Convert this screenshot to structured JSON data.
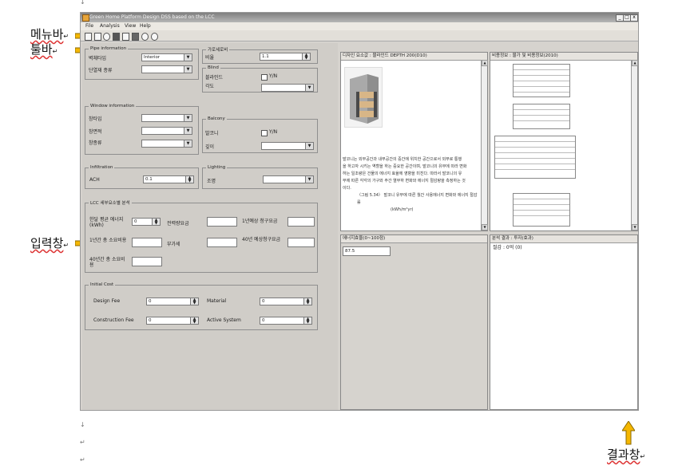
{
  "doc": {
    "marks": [
      "↓",
      "↓",
      "↵",
      "↵"
    ],
    "annotations": {
      "menubar": "메뉴바",
      "toolbar": "툴바",
      "input_window": "입력창",
      "result_window": "결과창",
      "return_mark": "↵"
    }
  },
  "window": {
    "title": "Green Home Platform Design DSS based on the LCC",
    "buttons": [
      "_",
      "□",
      "x"
    ]
  },
  "menu": [
    "File",
    "Analysis",
    "View",
    "Help"
  ],
  "toolbar_icons": [
    "open-icon",
    "new-icon",
    "edit-icon",
    "save-icon",
    "table-icon",
    "chart-icon",
    "settings-icon",
    "info-icon"
  ],
  "left": {
    "pipe": {
      "legend": "Pipe information",
      "wall_type_label": "벽체타입",
      "wall_type_value": "Interior",
      "insulation_label": "단열재 종류",
      "insulation_value": ""
    },
    "shading": {
      "legend": "가로세로비",
      "ratio_label": "비율",
      "ratio_value": "1.1"
    },
    "blind": {
      "legend": "Blind",
      "blind_label": "블라인드",
      "check_label": "Y/N",
      "angle_label": "각도",
      "angle_value": ""
    },
    "window_info": {
      "legend": "Window information",
      "type_label": "창타입",
      "area_label": "창면적",
      "kind_label": "창종류"
    },
    "balcony": {
      "legend": "Balcony",
      "balcony_label": "발코니",
      "check_label": "Y/N",
      "depth_label": "깊이"
    },
    "infiltration": {
      "legend": "Infiltration",
      "ach_label": "ACH",
      "ach_value": "0.1"
    },
    "lighting": {
      "legend": "Lighting",
      "light_label": "조명"
    },
    "lcc": {
      "legend": "LCC 세부요소별 분석",
      "annual_energy_label": "한달 평균 에너지(kWh)",
      "annual_energy_value": "0",
      "power_fee_label": "전력량요금",
      "yearly_bill_label": "1년예상 청구요금",
      "annual_cost_label": "1년간 총 소요비용",
      "vat_label": "부가세",
      "forty_year_label": "40년 예상청구요금",
      "forty_total_label": "40년간 총 소요비용"
    },
    "initial": {
      "legend": "Initial Cost",
      "design_fee_label": "Design Fee",
      "design_fee_value": "0",
      "material_label": "Material",
      "material_value": "0",
      "construction_label": "Construction Fee",
      "construction_value": "0",
      "active_label": "Active System",
      "active_value": "0"
    }
  },
  "middle": {
    "top_title": "디자인 요소값 : 블라인드 DEPTH 200(D10)",
    "paragraph": [
      "발코니는 외부공간과 내부공간의 중간에 위치한 공간으로서 외부로 통행",
      "을 하고자 시키는 역할을 하는 중요한 공간이며, 발코니의 유무에 따라 변화",
      "하는 일조량은 건물의 에너지 효율에 영향을 미친다. 따라서 발코니의 유",
      "무에 따른 각각의 가구와 주간 열부하 변화와 에너지 절감량을 측정하는 것",
      "이다."
    ],
    "caption": "〈그림 5.34〉 발코니 유무에 따른 월간 사용에너지 변화와 에너지 절감률",
    "caption2": "(kWh/m²yr)",
    "bottom_title": "에너지효율(0~100점)",
    "score_value": "87.5"
  },
  "right": {
    "top_title": "비용정보 : 물가 및 비용정보(2010)",
    "bottom_title": "분석 결과 : 투자(효과)",
    "result_text": "절감 : 0억 (0)"
  }
}
